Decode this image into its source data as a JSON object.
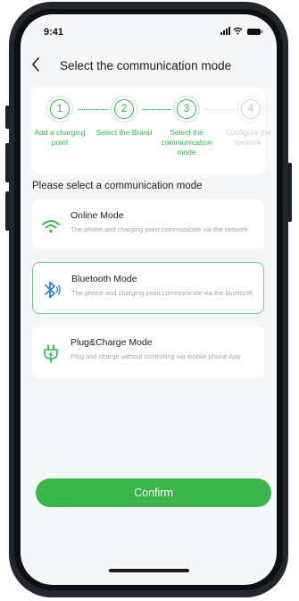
{
  "status_bar": {
    "time": "9:41"
  },
  "header": {
    "title": "Select the communication mode"
  },
  "steps": [
    {
      "number": "1",
      "label": "Add a charging point"
    },
    {
      "number": "2",
      "label": "Select the Brand"
    },
    {
      "number": "3",
      "label": "Select the communication mode"
    },
    {
      "number": "4",
      "label": "Configure the network"
    }
  ],
  "section_title": "Please select a communication mode",
  "options": [
    {
      "title": "Online Mode",
      "description": "The phone and charging point communicate via the network",
      "icon": "wifi-icon"
    },
    {
      "title": "Bluetooth Mode",
      "description": "The phone and charging point communicate via the bluetooth",
      "icon": "bluetooth-icon"
    },
    {
      "title": "Plug&Charge Mode",
      "description": "Plug and charge without controlling via mobile phone App",
      "icon": "plug-icon"
    }
  ],
  "selected_option": "Bluetooth Mode",
  "confirm_label": "Confirm",
  "colors": {
    "accent": "#3ab54a",
    "accent_light": "#6fcf82",
    "disabled": "#cfcfcf",
    "background": "#f6f7f8"
  }
}
